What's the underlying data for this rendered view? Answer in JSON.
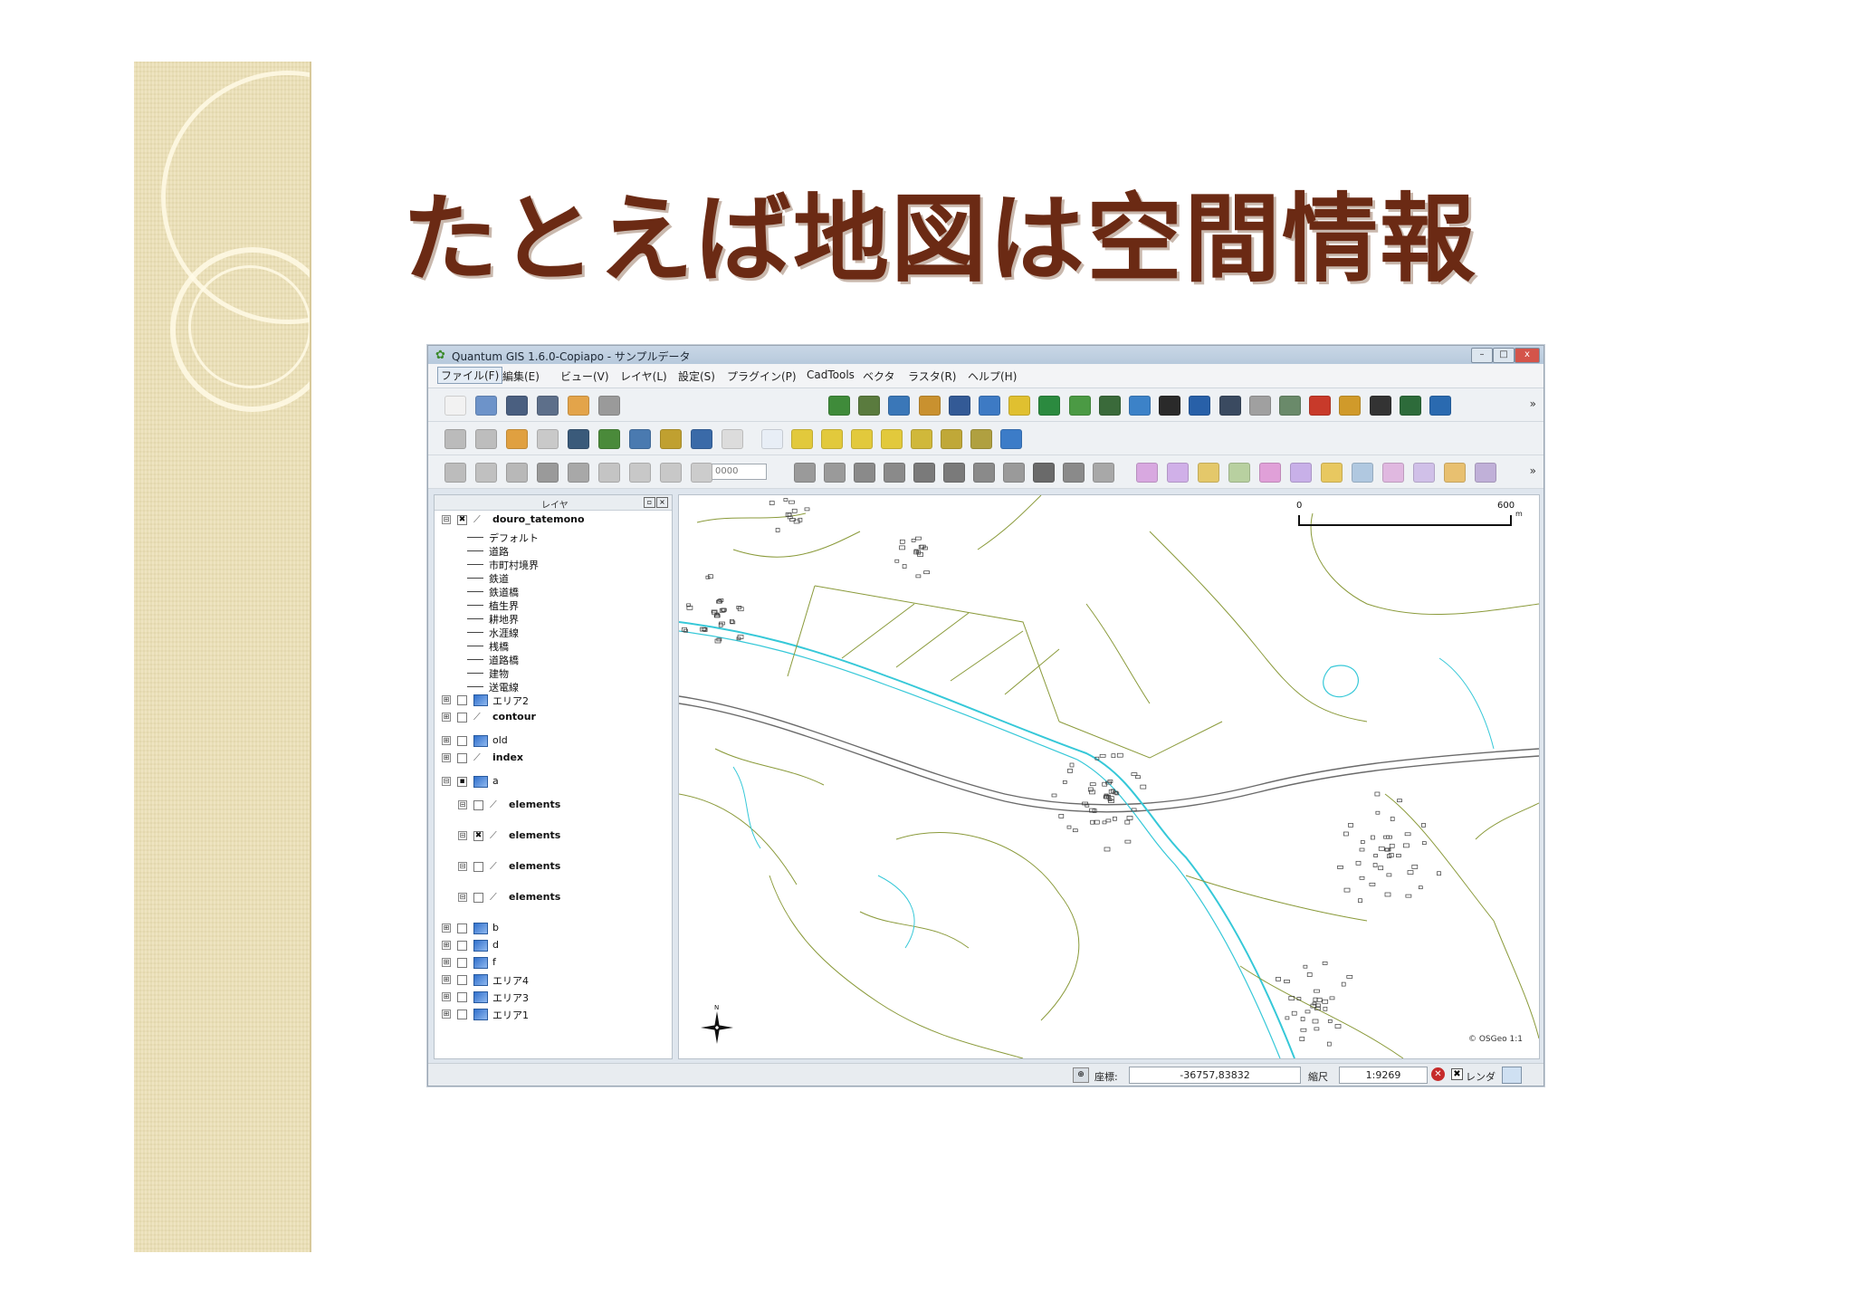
{
  "slide": {
    "title": "たとえば地図は空間情報"
  },
  "window": {
    "title": "Quantum GIS 1.6.0-Copiapo - サンプルデータ",
    "buttons": {
      "minimize": "–",
      "maximize": "□",
      "close": "x"
    }
  },
  "menu": {
    "items": [
      "ファイル(F)",
      "編集(E)",
      "ビュー(V)",
      "レイヤ(L)",
      "設定(S)",
      "プラグイン(P)",
      "CadTools",
      "ベクタ",
      "ラスタ(R)",
      "ヘルプ(H)"
    ]
  },
  "toolbars": {
    "more_label": "»",
    "row1": [
      {
        "icon": "new-project-icon",
        "color": "#f2f2f2"
      },
      {
        "icon": "open-project-icon",
        "color": "#6d93c9"
      },
      {
        "icon": "save-project-icon",
        "color": "#4a5f80"
      },
      {
        "icon": "save-as-icon",
        "color": "#5d6f8a"
      },
      {
        "icon": "print-composer-icon",
        "color": "#e3a44a"
      },
      {
        "icon": "print-icon",
        "color": "#9a9a9a"
      },
      {
        "icon": "add-vector-icon",
        "color": "#3f8b3a"
      },
      {
        "icon": "add-raster-icon",
        "color": "#5a7b3e"
      },
      {
        "icon": "add-postgis-icon",
        "color": "#3a77b8"
      },
      {
        "icon": "add-spatialite-icon",
        "color": "#c9912f"
      },
      {
        "icon": "wms-icon",
        "color": "#335a96"
      },
      {
        "icon": "new-shapefile-icon",
        "color": "#3d7ac4"
      },
      {
        "icon": "coordinate-capture-icon",
        "color": "#e0c030"
      },
      {
        "icon": "georeferencer-icon",
        "color": "#2b8a3f"
      },
      {
        "icon": "plugin-installer-icon",
        "color": "#4b9a44"
      },
      {
        "icon": "grid-icon",
        "color": "#3a6a3a"
      },
      {
        "icon": "globe-icon",
        "color": "#3c82c8"
      },
      {
        "icon": "histogram-icon",
        "color": "#2a2a2a"
      },
      {
        "icon": "north-arrow-icon",
        "color": "#2860a8"
      },
      {
        "icon": "filter-icon",
        "color": "#3a4a60"
      },
      {
        "icon": "eraser-icon",
        "color": "#a0a0a0"
      },
      {
        "icon": "gps-icon",
        "color": "#6a8a6a"
      },
      {
        "icon": "pdf-icon",
        "color": "#c83a2a"
      },
      {
        "icon": "edit-icon",
        "color": "#d09a2a"
      },
      {
        "icon": "line-icon",
        "color": "#333333"
      },
      {
        "icon": "db-icon",
        "color": "#2d6b3a"
      },
      {
        "icon": "osm-icon",
        "color": "#2a6ab0"
      }
    ],
    "row2": [
      {
        "icon": "toggle-editing-icon",
        "color": "#bbbbbb"
      },
      {
        "icon": "pencil-icon",
        "color": "#bdbdbd"
      },
      {
        "icon": "identify-features-icon",
        "color": "#e0a040"
      },
      {
        "icon": "attribute-table-icon",
        "color": "#c9c9c9"
      },
      {
        "icon": "field-calculator-icon",
        "color": "#3a5a7a"
      },
      {
        "icon": "tips-icon",
        "color": "#4a8a3a"
      },
      {
        "icon": "select-icon",
        "color": "#4a7ab0"
      },
      {
        "icon": "deselect-icon",
        "color": "#c0a030"
      },
      {
        "icon": "measure-icon",
        "color": "#3a6aa8"
      },
      {
        "icon": "text-annotation-icon",
        "color": "#dcdcdc"
      },
      {
        "icon": "pan-icon",
        "color": "#e8eef6"
      },
      {
        "icon": "zoom-in-icon",
        "color": "#e2c93c"
      },
      {
        "icon": "zoom-out-icon",
        "color": "#e2c93c"
      },
      {
        "icon": "zoom-full-icon",
        "color": "#e2c93c"
      },
      {
        "icon": "zoom-selection-icon",
        "color": "#e2c93c"
      },
      {
        "icon": "zoom-layer-icon",
        "color": "#d0b83a"
      },
      {
        "icon": "zoom-last-icon",
        "color": "#c0a838"
      },
      {
        "icon": "zoom-next-icon",
        "color": "#b0a040"
      },
      {
        "icon": "refresh-icon",
        "color": "#3c7cc8"
      }
    ],
    "row3": [
      {
        "icon": "digitize-line-icon",
        "color": "#bcbcbc"
      },
      {
        "icon": "digitize-polygon-icon",
        "color": "#c0c0c0"
      },
      {
        "icon": "move-feature-icon",
        "color": "#b8b8b8"
      },
      {
        "icon": "node-tool-icon",
        "color": "#9a9a9a"
      },
      {
        "icon": "delete-selected-icon",
        "color": "#a8a8a8"
      },
      {
        "icon": "cut-features-icon",
        "color": "#c4c4c4"
      },
      {
        "icon": "copy-features-icon",
        "color": "#c8c8c8"
      },
      {
        "icon": "paste-features-icon",
        "color": "#c8c8c8"
      },
      {
        "icon": "snapping-icon",
        "color": "#cccccc"
      },
      {
        "icon": "undo-icon",
        "color": "#9a9a9a"
      },
      {
        "icon": "redo-icon",
        "color": "#9a9a9a"
      },
      {
        "icon": "simplify-icon",
        "color": "#8a8a8a"
      },
      {
        "icon": "add-ring-icon",
        "color": "#8a8a8a"
      },
      {
        "icon": "add-part-icon",
        "color": "#7a7a7a"
      },
      {
        "icon": "delete-ring-icon",
        "color": "#7a7a7a"
      },
      {
        "icon": "delete-part-icon",
        "color": "#8a8a8a"
      },
      {
        "icon": "reshape-icon",
        "color": "#9a9a9a"
      },
      {
        "icon": "split-icon",
        "color": "#6a6a6a"
      },
      {
        "icon": "merge-icon",
        "color": "#8a8a8a"
      },
      {
        "icon": "rotate-icon",
        "color": "#a8a8a8"
      },
      {
        "icon": "cad-tool-1-icon",
        "color": "#d8a8e0"
      },
      {
        "icon": "cad-tool-2-icon",
        "color": "#d0b0e8"
      },
      {
        "icon": "cad-tool-3-icon",
        "color": "#e4c86a"
      },
      {
        "icon": "cad-tool-4-icon",
        "color": "#b8d0a0"
      },
      {
        "icon": "cad-tool-5-icon",
        "color": "#e0a0d8"
      },
      {
        "icon": "cad-tool-6-icon",
        "color": "#c8b0e8"
      },
      {
        "icon": "cad-tool-7-icon",
        "color": "#e8c860"
      },
      {
        "icon": "cad-tool-8-icon",
        "color": "#b0c8e0"
      },
      {
        "icon": "cad-tool-9-icon",
        "color": "#e0b8e0"
      },
      {
        "icon": "cad-tool-10-icon",
        "color": "#d0c0e8"
      },
      {
        "icon": "cad-tool-11-icon",
        "color": "#e8c070"
      },
      {
        "icon": "cad-tool-12-icon",
        "color": "#c0b0d8"
      }
    ],
    "rotate_value": "0000"
  },
  "layer_panel": {
    "title": "レイヤ",
    "tree": [
      {
        "depth": 0,
        "expander": "⊟",
        "checked": "✖",
        "type": "vector",
        "name": "douro_tatemono",
        "bold": true
      },
      {
        "depth": 1,
        "type": "legend",
        "name": "デフォルト"
      },
      {
        "depth": 1,
        "type": "legend",
        "name": "道路"
      },
      {
        "depth": 1,
        "type": "legend",
        "name": "市町村境界"
      },
      {
        "depth": 1,
        "type": "legend",
        "name": "鉄道"
      },
      {
        "depth": 1,
        "type": "legend",
        "name": "鉄道橋"
      },
      {
        "depth": 1,
        "type": "legend",
        "name": "植生界"
      },
      {
        "depth": 1,
        "type": "legend",
        "name": "耕地界"
      },
      {
        "depth": 1,
        "type": "legend",
        "name": "水涯線"
      },
      {
        "depth": 1,
        "type": "legend",
        "name": "桟橋"
      },
      {
        "depth": 1,
        "type": "legend",
        "name": "道路橋"
      },
      {
        "depth": 1,
        "type": "legend",
        "name": "建物"
      },
      {
        "depth": 1,
        "type": "legend",
        "name": "送電線"
      },
      {
        "depth": 0,
        "expander": "⊞",
        "checked": "",
        "type": "raster",
        "name": "エリア2"
      },
      {
        "depth": 0,
        "expander": "⊞",
        "checked": "",
        "type": "vector",
        "name": "contour",
        "bold": true
      },
      {
        "depth": 0,
        "expander": "⊞",
        "checked": "",
        "type": "raster",
        "name": "old"
      },
      {
        "depth": 0,
        "expander": "⊞",
        "checked": "",
        "type": "vector",
        "name": "index",
        "bold": true
      },
      {
        "depth": 0,
        "expander": "⊟",
        "checked": "▪",
        "type": "raster",
        "name": "a"
      },
      {
        "depth": 1,
        "expander": "⊟",
        "checked": "",
        "type": "vector",
        "name": "elements",
        "bold": true
      },
      {
        "depth": 1,
        "expander": "⊟",
        "checked": "✖",
        "type": "vector",
        "name": "elements",
        "bold": true
      },
      {
        "depth": 1,
        "expander": "⊟",
        "checked": "",
        "type": "vector",
        "name": "elements",
        "bold": true
      },
      {
        "depth": 1,
        "expander": "⊟",
        "checked": "",
        "type": "vector",
        "name": "elements",
        "bold": true
      },
      {
        "depth": 0,
        "expander": "⊞",
        "checked": "",
        "type": "raster",
        "name": "b"
      },
      {
        "depth": 0,
        "expander": "⊞",
        "checked": "",
        "type": "raster",
        "name": "d"
      },
      {
        "depth": 0,
        "expander": "⊞",
        "checked": "",
        "type": "raster",
        "name": "f"
      },
      {
        "depth": 0,
        "expander": "⊞",
        "checked": "",
        "type": "raster",
        "name": "エリア4"
      },
      {
        "depth": 0,
        "expander": "⊞",
        "checked": "",
        "type": "raster",
        "name": "エリア3"
      },
      {
        "depth": 0,
        "expander": "⊞",
        "checked": "",
        "type": "raster",
        "name": "エリア1"
      }
    ]
  },
  "map": {
    "scale_min": "0",
    "scale_max": "600",
    "scale_unit": "m",
    "north_label": "N",
    "watermark": "© OSGeo 1:1",
    "colors": {
      "road": "#8a9a3a",
      "water": "#36c8d8",
      "building": "#3a3a3a",
      "rail": "#666666"
    }
  },
  "statusbar": {
    "coord_label": "座標:",
    "coord_value": "-36757,83832",
    "scale_label": "縮尺",
    "scale_value": "1:9269",
    "render_label": "レンダ"
  }
}
